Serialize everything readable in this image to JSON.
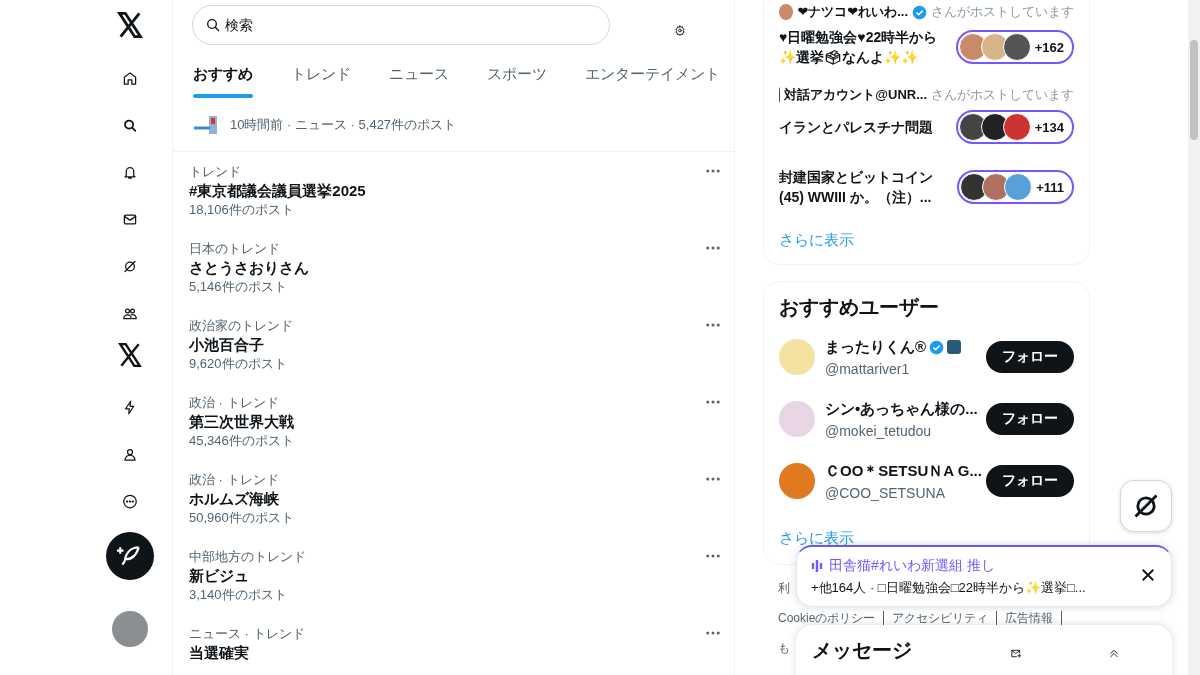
{
  "search": {
    "placeholder": "検索"
  },
  "tabs": [
    {
      "label": "おすすめ",
      "selected": true
    },
    {
      "label": "トレンド",
      "selected": false
    },
    {
      "label": "ニュース",
      "selected": false
    },
    {
      "label": "スポーツ",
      "selected": false
    },
    {
      "label": "エンターテイメント",
      "selected": false
    }
  ],
  "news_item": {
    "meta": "10時間前 · ニュース · 5,427件のポスト"
  },
  "trends": [
    {
      "category": "トレンド",
      "title": "#東京都議会議員選挙2025",
      "count": "18,106件のポスト"
    },
    {
      "category": "日本のトレンド",
      "title": "さとうさおりさん",
      "count": "5,146件のポスト"
    },
    {
      "category": "政治家のトレンド",
      "title": "小池百合子",
      "count": "9,620件のポスト"
    },
    {
      "category": "政治 · トレンド",
      "title": "第三次世界大戦",
      "count": "45,346件のポスト"
    },
    {
      "category": "政治 · トレンド",
      "title": "ホルムズ海峡",
      "count": "50,960件のポスト"
    },
    {
      "category": "中部地方のトレンド",
      "title": "新ビジュ",
      "count": "3,140件のポスト"
    },
    {
      "category": "ニュース · トレンド",
      "title": "当選確実"
    }
  ],
  "spaces": [
    {
      "host": "❤ナツコ❤れいわ...",
      "verified": true,
      "host_suffix": "さんがホストしています",
      "title": "♥日曜勉強会♥22時半から✨選挙🗳なんよ✨✨",
      "listeners": "+162"
    },
    {
      "host": "対話アカウント@UNR...",
      "verified": false,
      "host_suffix": "さんがホストしています",
      "title": "イランとパレスチナ問題",
      "listeners": "+134"
    },
    {
      "title": "封建国家とビットコイン(45) WWIII か。（注）...",
      "listeners": "+111"
    }
  ],
  "spaces_more": "さらに表示",
  "who_to_follow": {
    "title": "おすすめユーザー",
    "users": [
      {
        "name": "まったりくん®",
        "verified": true,
        "affiliate_badge": true,
        "handle": "@mattariver1",
        "button": "フォロー"
      },
      {
        "name": "シン•あっちゃん様の...",
        "verified": false,
        "affiliate_badge": false,
        "handle": "@mokei_tetudou",
        "button": "フォロー"
      },
      {
        "name": "ＣOO＊SETSUＮA G...",
        "verified": false,
        "affiliate_badge": false,
        "handle": "@COO_SETSUNA",
        "button": "フォロー"
      }
    ],
    "more": "さらに表示"
  },
  "footer_links": [
    "利",
    "Cookieのポリシー",
    "アクセシビリティ",
    "広告情報",
    "も"
  ],
  "space_bar": {
    "title": "田舎猫#れいわ新選組 推し",
    "subtitle": "+他164人 · □日曜勉強会□22時半から✨選挙□..."
  },
  "messages": {
    "title": "メッセージ"
  }
}
